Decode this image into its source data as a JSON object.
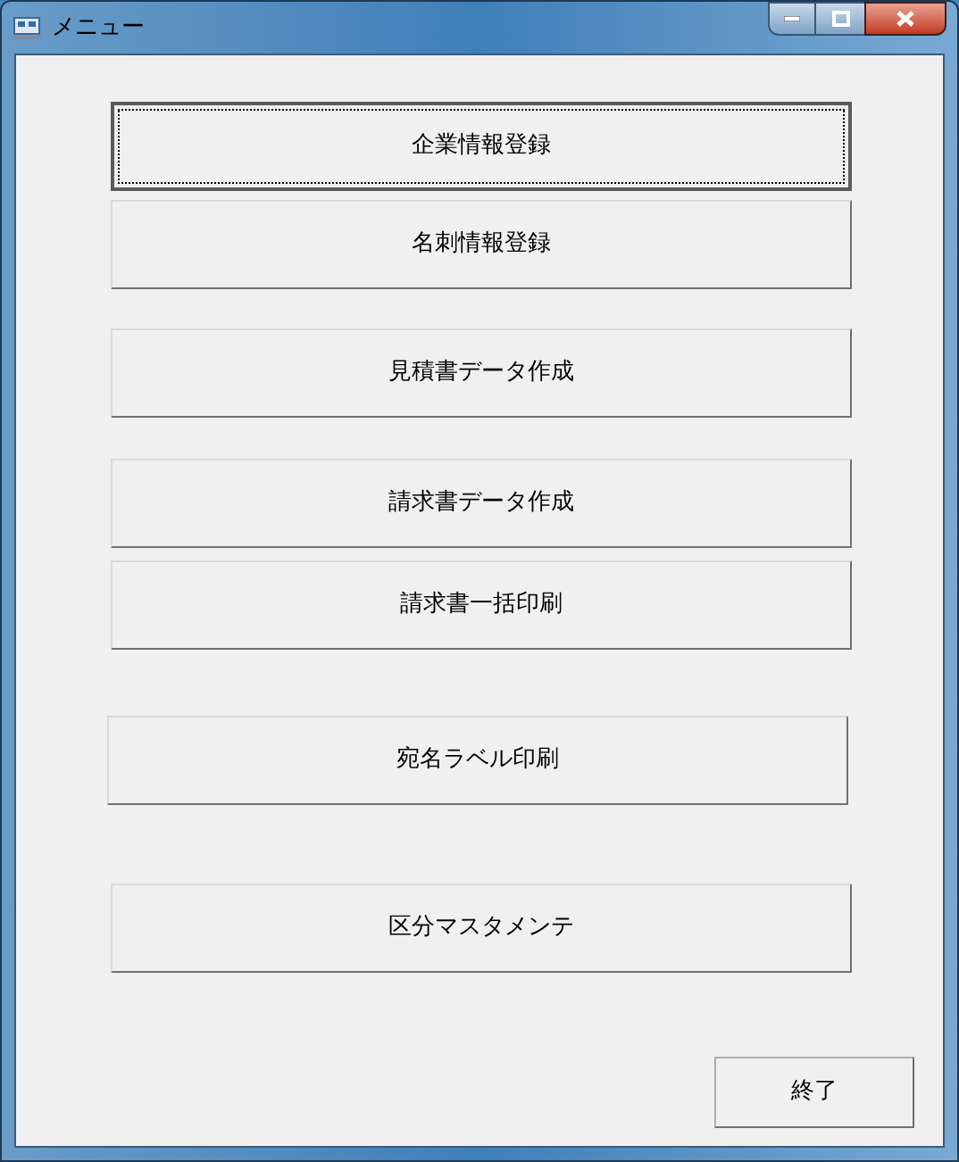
{
  "window": {
    "title": "メニュー"
  },
  "buttons": [
    {
      "label": "企業情報登録",
      "focused": true
    },
    {
      "label": "名刺情報登録",
      "focused": false
    },
    {
      "label": "見積書データ作成",
      "focused": false
    },
    {
      "label": "請求書データ作成",
      "focused": false
    },
    {
      "label": "請求書一括印刷",
      "focused": false
    },
    {
      "label": "宛名ラベル印刷",
      "focused": false
    },
    {
      "label": "区分マスタメンテ",
      "focused": false
    }
  ],
  "exit_button": {
    "label": "終了"
  }
}
